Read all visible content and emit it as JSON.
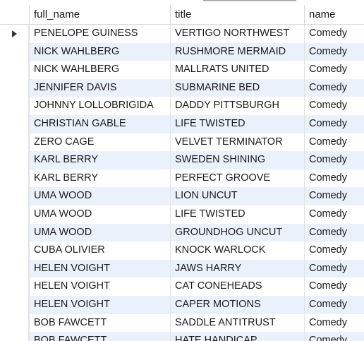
{
  "columns": [
    "full_name",
    "title",
    "name"
  ],
  "rows": [
    [
      "PENELOPE GUINESS",
      "VERTIGO NORTHWEST",
      "Comedy"
    ],
    [
      "NICK WAHLBERG",
      "RUSHMORE MERMAID",
      "Comedy"
    ],
    [
      "NICK WAHLBERG",
      "MALLRATS UNITED",
      "Comedy"
    ],
    [
      "JENNIFER DAVIS",
      "SUBMARINE BED",
      "Comedy"
    ],
    [
      "JOHNNY LOLLOBRIGIDA",
      "DADDY PITTSBURGH",
      "Comedy"
    ],
    [
      "CHRISTIAN GABLE",
      "LIFE TWISTED",
      "Comedy"
    ],
    [
      "ZERO CAGE",
      "VELVET TERMINATOR",
      "Comedy"
    ],
    [
      "KARL BERRY",
      "SWEDEN SHINING",
      "Comedy"
    ],
    [
      "KARL BERRY",
      "PERFECT GROOVE",
      "Comedy"
    ],
    [
      "UMA WOOD",
      "LION UNCUT",
      "Comedy"
    ],
    [
      "UMA WOOD",
      "LIFE TWISTED",
      "Comedy"
    ],
    [
      "UMA WOOD",
      "GROUNDHOG UNCUT",
      "Comedy"
    ],
    [
      "CUBA OLIVIER",
      "KNOCK WARLOCK",
      "Comedy"
    ],
    [
      "HELEN VOIGHT",
      "JAWS HARRY",
      "Comedy"
    ],
    [
      "HELEN VOIGHT",
      "CAT CONEHEADS",
      "Comedy"
    ],
    [
      "HELEN VOIGHT",
      "CAPER MOTIONS",
      "Comedy"
    ],
    [
      "BOB FAWCETT",
      "SADDLE ANTITRUST",
      "Comedy"
    ],
    [
      "BOB FAWCETT",
      "HATE HANDICAP",
      "Comedy"
    ]
  ],
  "current_row_marker": "current-row-arrow-icon",
  "colors": {
    "alt_row": "#ebf1fb",
    "grid_line": "#e2e2e2"
  }
}
